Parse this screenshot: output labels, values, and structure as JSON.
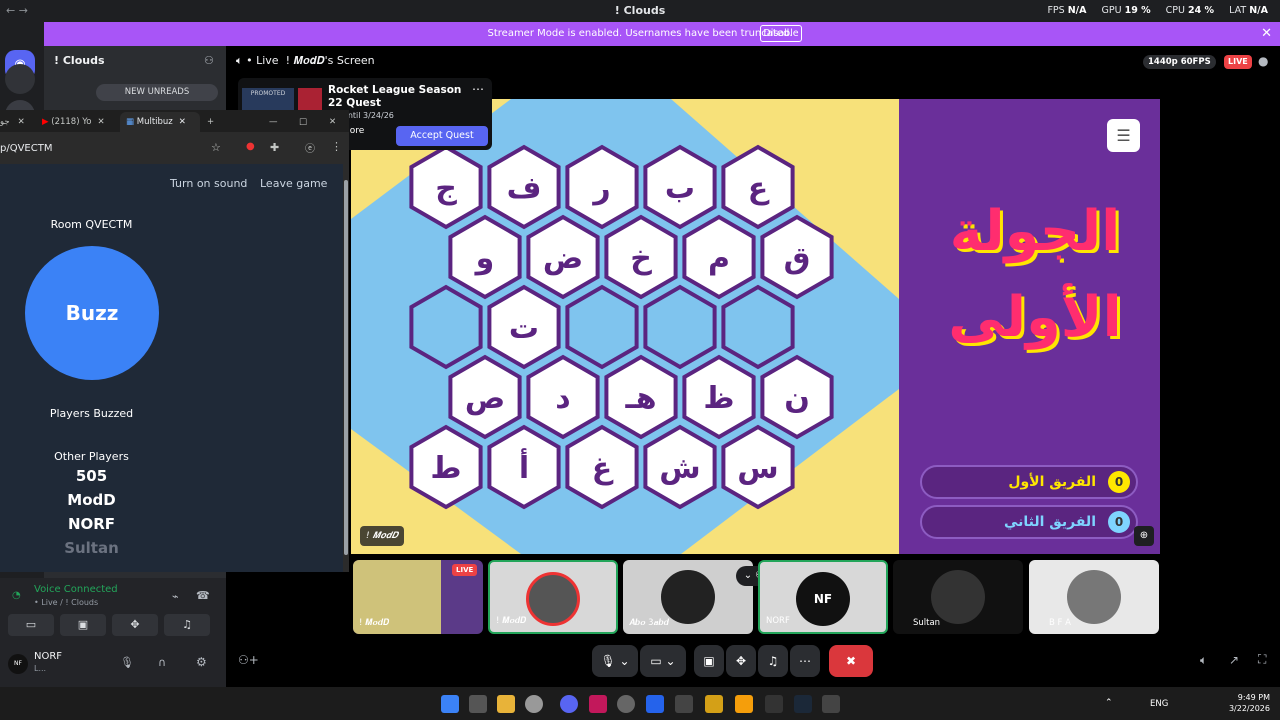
{
  "titlebar": {
    "title": "! Clouds",
    "fps_label": "FPS",
    "fps_value": "N/A",
    "gpu_label": "GPU",
    "gpu_value": "19 %",
    "cpu_label": "CPU",
    "cpu_value": "24 %",
    "lat_label": "LAT",
    "lat_value": "N/A"
  },
  "banner": {
    "message": "Streamer Mode is enabled. Usernames have been truncated.",
    "disable_label": "Disable"
  },
  "server": {
    "name": "! Clouds",
    "new_unreads": "NEW UNREADS"
  },
  "stream_header": {
    "live_label": "• Live",
    "screen_title": "! 𝑴𝒐𝒅𝑫's Screen",
    "resolution": "1440p 60FPS",
    "live_badge": "LIVE"
  },
  "quest": {
    "tag": "PROMOTED",
    "title": "Rocket League Season 22 Quest",
    "availability": "ble until 3/24/26",
    "more_label": "More",
    "accept_label": "Accept Quest"
  },
  "browser": {
    "tabs": [
      {
        "label": "جو"
      },
      {
        "label": "(2118) Yo"
      },
      {
        "label": "Multibuz"
      }
    ],
    "url": "p/QVECTM",
    "turn_on_sound": "Turn on sound",
    "leave_game": "Leave game",
    "room_label": "Room QVECTM",
    "buzz_label": "Buzz",
    "players_buzzed": "Players Buzzed",
    "other_players": "Other Players",
    "players": [
      "505",
      "ModD",
      "NORF",
      "Sultan"
    ]
  },
  "game": {
    "round_title": "الجولة الأولى",
    "team1": {
      "name": "الفريق الأول",
      "score": "0"
    },
    "team2": {
      "name": "الفريق الثاني",
      "score": "0"
    },
    "streamer_tag": "! 𝑴𝒐𝒅𝑫",
    "hex_rows": [
      [
        "ج",
        "ف",
        "ر",
        "ب",
        "ع"
      ],
      [
        "و",
        "ض",
        "خ",
        "م",
        "ق"
      ],
      [
        "",
        "ت",
        "",
        "",
        ""
      ],
      [
        "ص",
        "د",
        "هـ",
        "ظ",
        "ن"
      ],
      [
        "ط",
        "أ",
        "غ",
        "ش",
        "س"
      ]
    ]
  },
  "voice": {
    "status": "Voice Connected",
    "channel": "• Live / ! Clouds"
  },
  "user": {
    "name": "NORF",
    "status": "L...",
    "avatar_text": "NF"
  },
  "tiles": [
    {
      "label": "! 𝑴𝒐𝒅𝑫",
      "live": "LIVE"
    },
    {
      "label": "! 𝑴𝒐𝒅𝑫"
    },
    {
      "label": "𝑨𝒃𝒐 3𝒂𝒃𝒅"
    },
    {
      "label": "NORF",
      "avatar": "NF"
    },
    {
      "label": "Sultan"
    },
    {
      "label": "B F A"
    }
  ],
  "taskbar": {
    "language": "ENG",
    "time": "9:49 PM",
    "date": "3/22/2026"
  },
  "colors": {
    "accent": "#5865f2",
    "banner": "#a855f7",
    "danger": "#da373c",
    "board_yellow": "#f7e17a",
    "board_blue": "#7fc4ee",
    "panel_purple": "#6a2f9a",
    "hex_border": "#5b2480"
  }
}
